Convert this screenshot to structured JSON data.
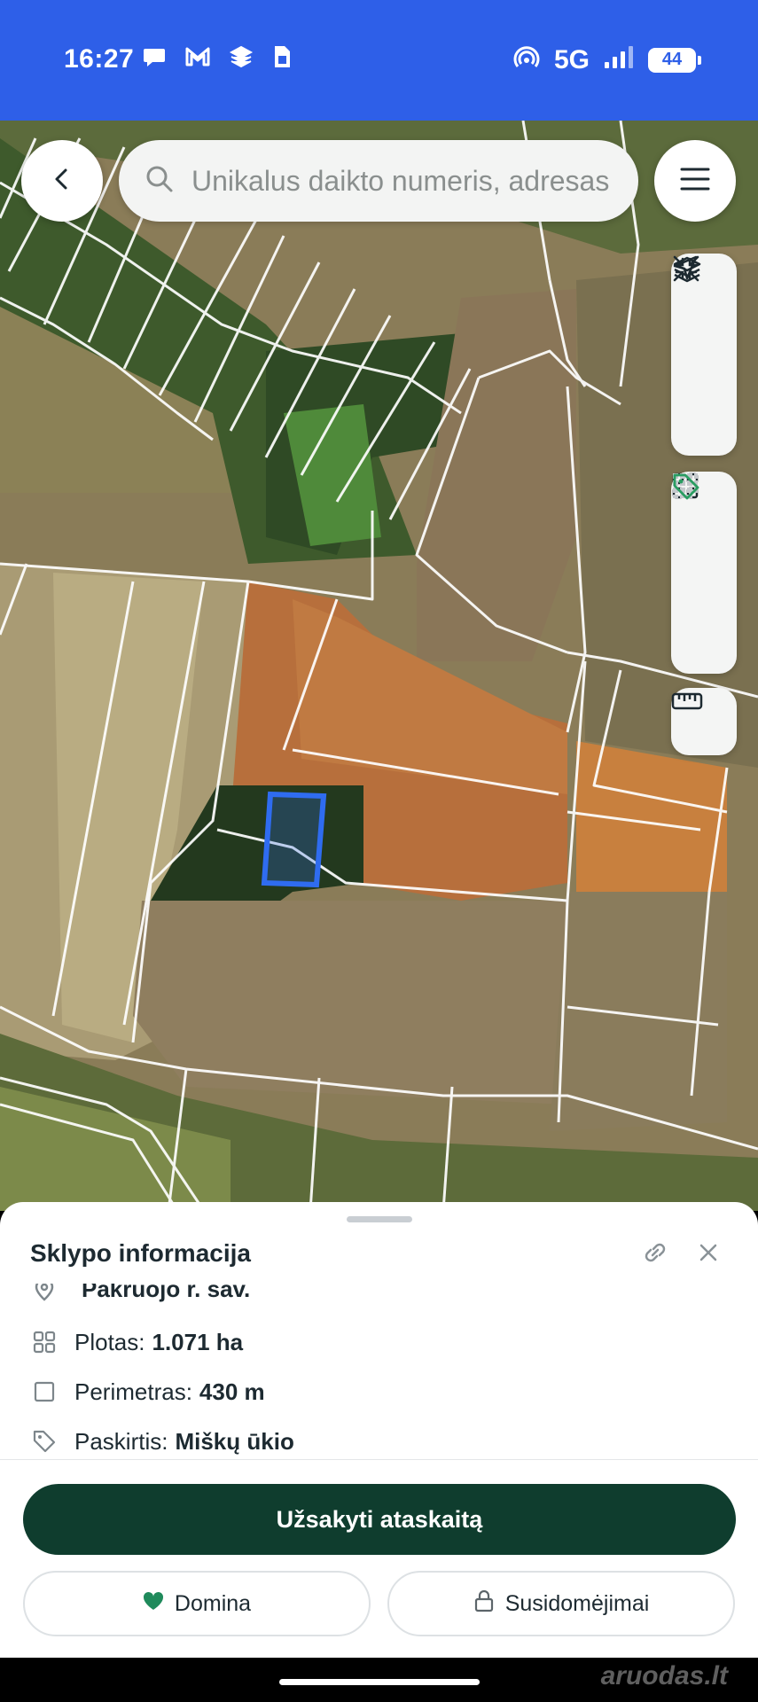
{
  "status_bar": {
    "time": "16:27",
    "network": "5G",
    "battery": "44",
    "icons": [
      "chat-bubble-icon",
      "gmail-icon",
      "layers-app-icon",
      "sim-card-icon",
      "hotspot-icon",
      "signal-bars-icon"
    ]
  },
  "search": {
    "placeholder": "Unikalus daikto numeris, adresas"
  },
  "map_tools": {
    "group1": [
      "layers-icon",
      "collapse-icon",
      "locate-icon"
    ],
    "group2": [
      "grid-icon",
      "pixel-grid-icon",
      "tag-icon"
    ],
    "group3": [
      "ruler-icon"
    ],
    "accent_color": "#2a9d62"
  },
  "sheet": {
    "title": "Sklypo informacija",
    "rows": [
      {
        "label": "",
        "value": "Pakruojo r. sav.",
        "icon": "location-pin-icon"
      },
      {
        "label": "Plotas:",
        "value": "1.071 ha",
        "icon": "grid-icon"
      },
      {
        "label": "Perimetras:",
        "value": "430 m",
        "icon": "square-icon"
      },
      {
        "label": "Paskirtis:",
        "value": "Miškų ūkio",
        "icon": "tag-icon"
      }
    ],
    "primary_button": "Užsakyti ataskaitą",
    "secondary_left": "Domina",
    "secondary_right": "Susidomėjimai"
  },
  "watermark": "aruodas.lt",
  "colors": {
    "status_bar": "#2e5fe8",
    "primary_button": "#0f3d2e",
    "heart": "#1f8a5b",
    "parcel_outline": "#2f6cf0"
  }
}
